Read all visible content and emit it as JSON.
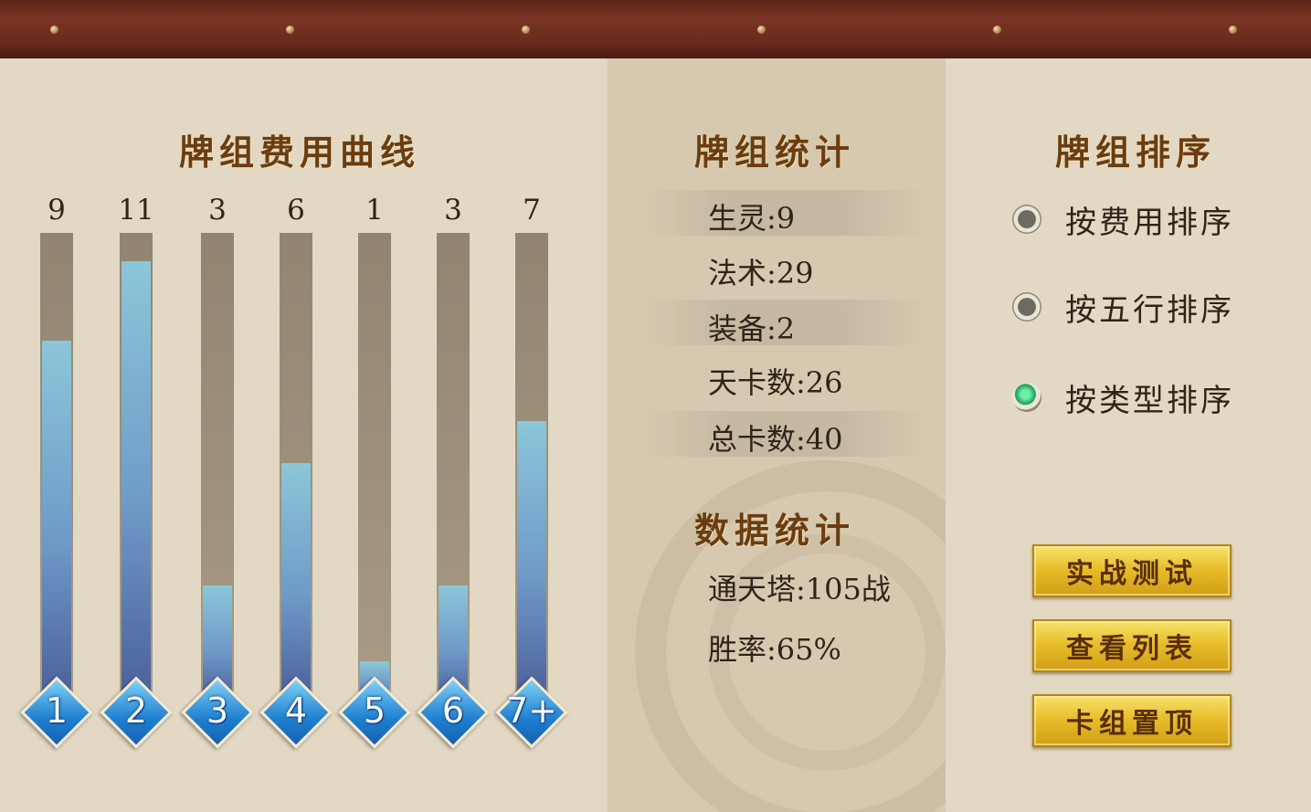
{
  "cost_curve": {
    "title": "牌组费用曲线",
    "bars": [
      {
        "count": "9",
        "label": "1",
        "level": 0.77
      },
      {
        "count": "11",
        "label": "2",
        "level": 0.94
      },
      {
        "count": "3",
        "label": "3",
        "level": 0.25
      },
      {
        "count": "6",
        "label": "4",
        "level": 0.51
      },
      {
        "count": "1",
        "label": "5",
        "level": 0.09
      },
      {
        "count": "3",
        "label": "6",
        "level": 0.25
      },
      {
        "count": "7",
        "label": "7+",
        "level": 0.6
      }
    ]
  },
  "deck_stats": {
    "title": "牌组统计",
    "rows": [
      "生灵:9",
      "法术:29",
      "装备:2",
      "天卡数:26",
      "总卡数:40"
    ]
  },
  "data_stats": {
    "title": "数据统计",
    "rows": [
      "通天塔:105战",
      "胜率:65%"
    ]
  },
  "sort": {
    "title": "牌组排序",
    "options": [
      {
        "label": "按费用排序",
        "selected": false
      },
      {
        "label": "按五行排序",
        "selected": false
      },
      {
        "label": "按类型排序",
        "selected": true
      }
    ]
  },
  "buttons": {
    "battle_test": "实战测试",
    "view_list": "查看列表",
    "pin_deck": "卡组置顶"
  },
  "colors": {
    "heading": "#6b3d0e",
    "bar_fill": "#6f9ac8",
    "radio_selected": "#1e9c5c",
    "button_gold": "#e8be2c"
  }
}
